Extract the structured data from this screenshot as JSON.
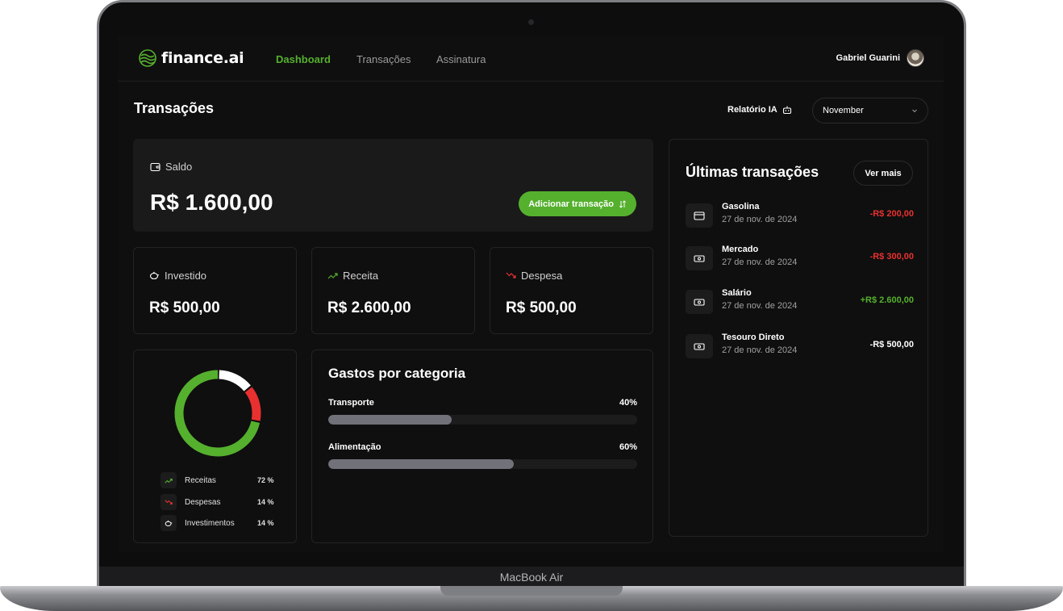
{
  "device": {
    "chin_label": "MacBook Air"
  },
  "nav": {
    "logo": "finance.ai",
    "links": [
      "Dashboard",
      "Transações",
      "Assinatura"
    ],
    "active_link": "Dashboard",
    "user_name": "Gabriel Guarini"
  },
  "header": {
    "title": "Transações",
    "ai_report_label": "Relatório IA",
    "month_selected": "November"
  },
  "balance": {
    "label": "Saldo",
    "amount": "R$ 1.600,00",
    "add_button_label": "Adicionar transação"
  },
  "summary": [
    {
      "label": "Investido",
      "amount": "R$ 500,00",
      "icon": "piggy-bank-icon",
      "color": "#ffffff"
    },
    {
      "label": "Receita",
      "amount": "R$ 2.600,00",
      "icon": "trending-up-icon",
      "color": "#55b02e"
    },
    {
      "label": "Despesa",
      "amount": "R$ 500,00",
      "icon": "trending-down-icon",
      "color": "#e93030"
    }
  ],
  "donut": {
    "segments": [
      {
        "name": "Receitas",
        "percent": 72,
        "color": "#55b02e"
      },
      {
        "name": "Despesas",
        "percent": 14,
        "color": "#e93030"
      },
      {
        "name": "Investimentos",
        "percent": 14,
        "color": "#ffffff"
      }
    ],
    "legend": [
      {
        "name": "Receitas",
        "pct_label": "72 %",
        "icon": "trending-up-icon"
      },
      {
        "name": "Despesas",
        "pct_label": "14 %",
        "icon": "trending-down-icon"
      },
      {
        "name": "Investimentos",
        "pct_label": "14 %",
        "icon": "piggy-bank-icon"
      }
    ]
  },
  "categories": {
    "title": "Gastos por categoria",
    "items": [
      {
        "name": "Transporte",
        "pct_label": "40%",
        "fraction": 0.4
      },
      {
        "name": "Alimentação",
        "pct_label": "60%",
        "fraction": 0.6
      }
    ]
  },
  "transactions": {
    "title": "Últimas transações",
    "see_more_label": "Ver mais",
    "items": [
      {
        "name": "Gasolina",
        "date": "27 de nov. de 2024",
        "amount": "-R$ 200,00",
        "icon": "credit-card-icon",
        "color": "#e93030"
      },
      {
        "name": "Mercado",
        "date": "27 de nov. de 2024",
        "amount": "-R$ 300,00",
        "icon": "cash-icon",
        "color": "#e93030"
      },
      {
        "name": "Salário",
        "date": "27 de nov. de 2024",
        "amount": "+R$ 2.600,00",
        "icon": "cash-icon",
        "color": "#55b02e"
      },
      {
        "name": "Tesouro Direto",
        "date": "27 de nov. de 2024",
        "amount": "-R$ 500,00",
        "icon": "cash-icon",
        "color": "#ffffff"
      }
    ]
  },
  "colors": {
    "accent": "#55b02e",
    "danger": "#e93030",
    "background": "#0f0f0f"
  }
}
